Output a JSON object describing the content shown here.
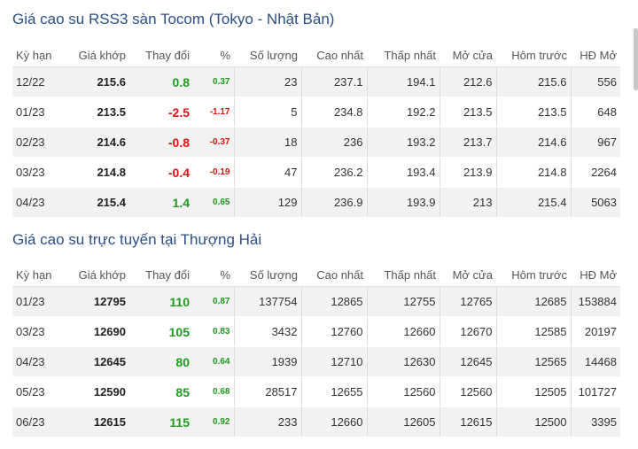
{
  "section1": {
    "title": "Giá cao su RSS3 sàn Tocom (Tokyo - Nhật Bản)",
    "headers": [
      "Kỳ hạn",
      "Giá khớp",
      "Thay đổi",
      "%",
      "Số lượng",
      "Cao nhất",
      "Thấp nhất",
      "Mở cửa",
      "Hôm trước",
      "HĐ Mở"
    ],
    "rows": [
      {
        "term": "12/22",
        "price": "215.6",
        "change": "0.8",
        "pct": "0.37",
        "dir": "up",
        "volume": "23",
        "high": "237.1",
        "low": "194.1",
        "open": "212.6",
        "prev": "215.6",
        "oi": "556"
      },
      {
        "term": "01/23",
        "price": "213.5",
        "change": "-2.5",
        "pct": "-1.17",
        "dir": "down",
        "volume": "5",
        "high": "234.8",
        "low": "192.2",
        "open": "213.5",
        "prev": "213.5",
        "oi": "648"
      },
      {
        "term": "02/23",
        "price": "214.6",
        "change": "-0.8",
        "pct": "-0.37",
        "dir": "down",
        "volume": "18",
        "high": "236",
        "low": "193.2",
        "open": "213.7",
        "prev": "214.6",
        "oi": "967"
      },
      {
        "term": "03/23",
        "price": "214.8",
        "change": "-0.4",
        "pct": "-0.19",
        "dir": "down",
        "volume": "47",
        "high": "236.2",
        "low": "193.4",
        "open": "213.9",
        "prev": "214.8",
        "oi": "2264"
      },
      {
        "term": "04/23",
        "price": "215.4",
        "change": "1.4",
        "pct": "0.65",
        "dir": "up",
        "volume": "129",
        "high": "236.9",
        "low": "193.9",
        "open": "213",
        "prev": "215.4",
        "oi": "5063"
      }
    ]
  },
  "section2": {
    "title": "Giá cao su trực tuyến tại Thượng Hải",
    "headers": [
      "Kỳ hạn",
      "Giá khớp",
      "Thay đổi",
      "%",
      "Số lượng",
      "Cao nhất",
      "Thấp nhất",
      "Mở cửa",
      "Hôm trước",
      "HĐ Mở"
    ],
    "rows": [
      {
        "term": "01/23",
        "price": "12795",
        "change": "110",
        "pct": "0.87",
        "dir": "up",
        "volume": "137754",
        "high": "12865",
        "low": "12755",
        "open": "12765",
        "prev": "12685",
        "oi": "153884"
      },
      {
        "term": "03/23",
        "price": "12690",
        "change": "105",
        "pct": "0.83",
        "dir": "up",
        "volume": "3432",
        "high": "12760",
        "low": "12660",
        "open": "12670",
        "prev": "12585",
        "oi": "20197"
      },
      {
        "term": "04/23",
        "price": "12645",
        "change": "80",
        "pct": "0.64",
        "dir": "up",
        "volume": "1939",
        "high": "12710",
        "low": "12630",
        "open": "12645",
        "prev": "12565",
        "oi": "14468"
      },
      {
        "term": "05/23",
        "price": "12590",
        "change": "85",
        "pct": "0.68",
        "dir": "up",
        "volume": "28517",
        "high": "12655",
        "low": "12560",
        "open": "12560",
        "prev": "12505",
        "oi": "101727"
      },
      {
        "term": "06/23",
        "price": "12615",
        "change": "115",
        "pct": "0.92",
        "dir": "up",
        "volume": "233",
        "high": "12660",
        "low": "12605",
        "open": "12615",
        "prev": "12500",
        "oi": "3395"
      }
    ]
  },
  "colors": {
    "title": "#2a4f86",
    "up": "#1f9a1f",
    "down": "#e01010",
    "row_alt": "#f2f2f2"
  }
}
